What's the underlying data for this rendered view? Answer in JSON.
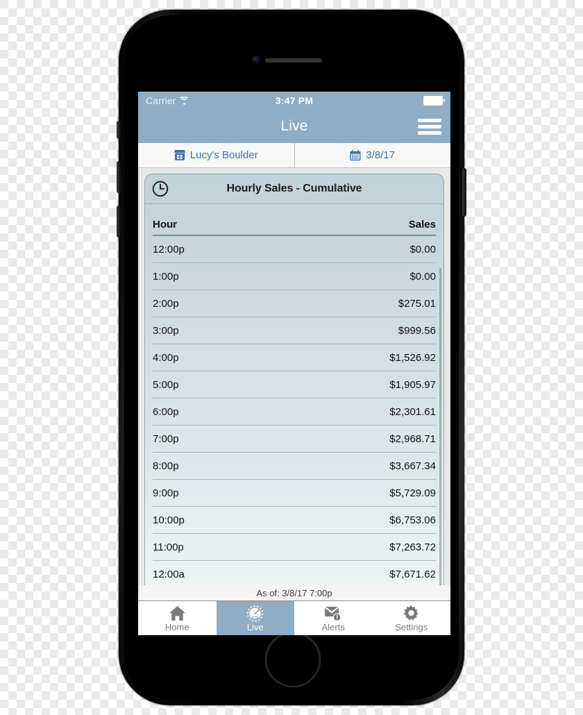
{
  "status_bar": {
    "carrier": "Carrier",
    "time": "3:47 PM",
    "wifi_icon": "wifi-icon",
    "battery_icon": "battery-icon"
  },
  "nav": {
    "title": "Live",
    "menu_icon": "hamburger-menu-icon"
  },
  "segments": [
    {
      "label": "Lucy's Boulder",
      "icon": "storefront-icon"
    },
    {
      "label": "3/8/17",
      "icon": "calendar-icon"
    }
  ],
  "card": {
    "icon": "clock-icon",
    "title": "Hourly Sales - Cumulative",
    "columns": {
      "hour": "Hour",
      "sales": "Sales"
    }
  },
  "chart_data": {
    "type": "table",
    "title": "Hourly Sales - Cumulative",
    "xlabel": "Hour",
    "ylabel": "Sales",
    "categories": [
      "12:00p",
      "1:00p",
      "2:00p",
      "3:00p",
      "4:00p",
      "5:00p",
      "6:00p",
      "7:00p",
      "8:00p",
      "9:00p",
      "10:00p",
      "11:00p",
      "12:00a"
    ],
    "values": [
      0.0,
      0.0,
      275.01,
      999.56,
      1526.92,
      1905.97,
      2301.61,
      2968.71,
      3667.34,
      5729.09,
      6753.06,
      7263.72,
      7671.62
    ],
    "rows": [
      {
        "hour": "12:00p",
        "sales": "$0.00"
      },
      {
        "hour": "1:00p",
        "sales": "$0.00"
      },
      {
        "hour": "2:00p",
        "sales": "$275.01"
      },
      {
        "hour": "3:00p",
        "sales": "$999.56"
      },
      {
        "hour": "4:00p",
        "sales": "$1,526.92"
      },
      {
        "hour": "5:00p",
        "sales": "$1,905.97"
      },
      {
        "hour": "6:00p",
        "sales": "$2,301.61"
      },
      {
        "hour": "7:00p",
        "sales": "$2,968.71"
      },
      {
        "hour": "8:00p",
        "sales": "$3,667.34"
      },
      {
        "hour": "9:00p",
        "sales": "$5,729.09"
      },
      {
        "hour": "10:00p",
        "sales": "$6,753.06"
      },
      {
        "hour": "11:00p",
        "sales": "$7,263.72"
      },
      {
        "hour": "12:00a",
        "sales": "$7,671.62"
      }
    ]
  },
  "footer": {
    "as_of": "As of: 3/8/17 7:00p"
  },
  "tabbar": {
    "items": [
      {
        "label": "Home",
        "icon": "home-icon",
        "active": false
      },
      {
        "label": "Live",
        "icon": "speedometer-icon",
        "active": true
      },
      {
        "label": "Alerts",
        "icon": "envelope-alert-icon",
        "active": false
      },
      {
        "label": "Settings",
        "icon": "gear-icon",
        "active": false
      }
    ]
  },
  "colors": {
    "accent": "#8fadc4",
    "link": "#3a72b0",
    "card_top": "#bdd3d8",
    "card_bottom": "#eef3f4"
  }
}
